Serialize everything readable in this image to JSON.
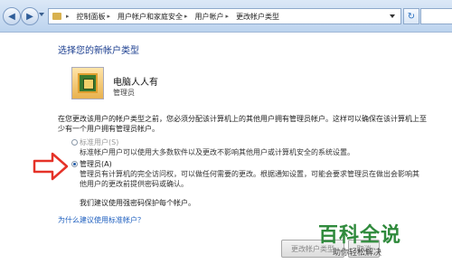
{
  "addressbar": {
    "crumbs": [
      "控制面板",
      "用户帐户和家庭安全",
      "用户帐户",
      "更改帐户类型"
    ]
  },
  "page": {
    "heading": "选择您的新帐户类型",
    "account_name": "电脑人人有",
    "account_role": "管理员",
    "description": "在您更改该用户的帐户类型之前，您必须分配该计算机上的其他用户拥有管理员帐户。这样可以确保在该计算机上至少有一个用户拥有管理员帐户。"
  },
  "options": {
    "standard": {
      "label": "标准用户(S)",
      "desc": "标准帐户用户可以使用大多数软件以及更改不影响其他用户或计算机安全的系统设置。",
      "selected": false,
      "enabled": false
    },
    "admin": {
      "label": "管理员(A)",
      "desc": "管理员有计算机的完全访问权，可以做任何需要的更改。根据通知设置，可能会要求管理员在做出会影响其他用户的更改前提供密码或确认。",
      "selected": true
    }
  },
  "recommend_text": "我们建议使用强密码保护每个帐户。",
  "link_text": "为什么建议使用标准帐户？",
  "buttons": {
    "change": "更改帐户类型",
    "cancel": "取消"
  },
  "watermark": {
    "logo": "百科全说",
    "sub": "助你轻松解决"
  },
  "colors": {
    "heading": "#1a3d8f",
    "link": "#1e5fbf",
    "arrow": "#e53228",
    "watermark": "#2f8a3c"
  }
}
